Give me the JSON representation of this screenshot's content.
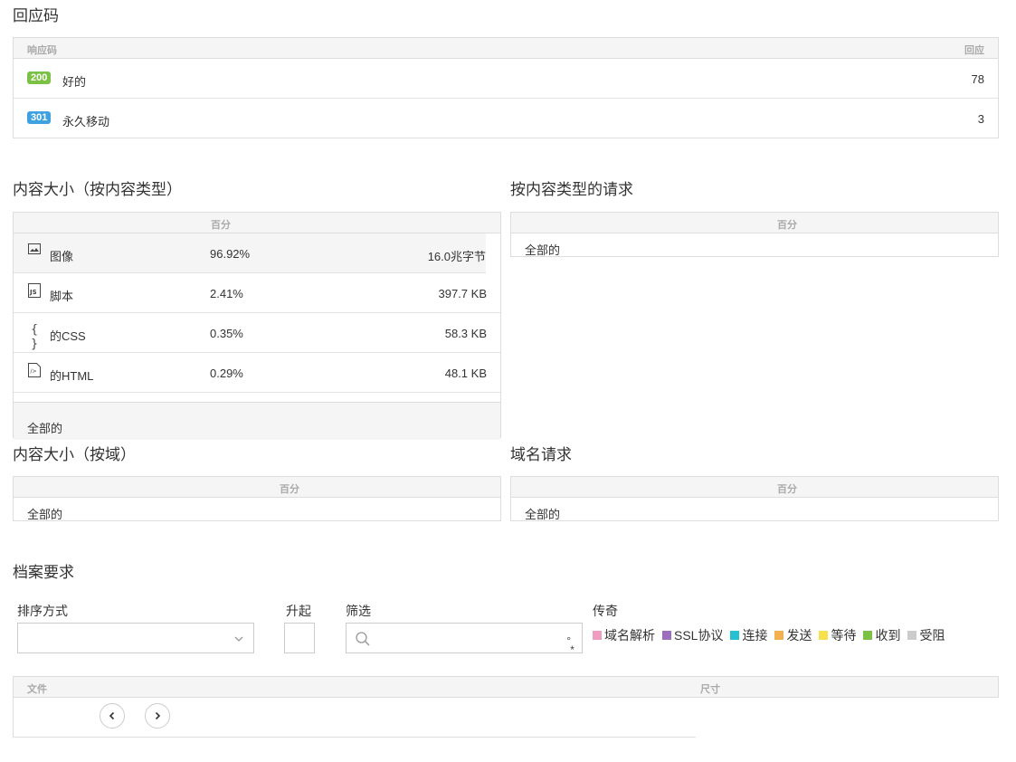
{
  "response_codes": {
    "title": "回应码",
    "header": {
      "code": "响应码",
      "count": "回应"
    },
    "rows": [
      {
        "badge": "200",
        "badge_color": "#7bc143",
        "label": "好的",
        "count": "78"
      },
      {
        "badge": "301",
        "badge_color": "#3ea1e0",
        "label": "永久移动",
        "count": "3"
      }
    ]
  },
  "content_size_by_type": {
    "title": "内容大小（按内容类型）",
    "header": {
      "percent": "百分"
    },
    "rows": [
      {
        "icon": "image-icon",
        "label": "图像",
        "percent": "96.92%",
        "size": "16.0兆字节"
      },
      {
        "icon": "js-file-icon",
        "label": "脚本",
        "percent": "2.41%",
        "size": "397.7 KB"
      },
      {
        "icon": "css-braces-icon",
        "label": "的CSS",
        "percent": "0.35%",
        "size": "58.3 KB"
      },
      {
        "icon": "html-file-icon",
        "label": "的HTML",
        "percent": "0.29%",
        "size": "48.1 KB"
      }
    ],
    "footer": "全部的"
  },
  "requests_by_type": {
    "title": "按内容类型的请求",
    "header": {
      "percent": "百分"
    },
    "footer": "全部的"
  },
  "content_size_by_domain": {
    "title": "内容大小（按域）",
    "header": {
      "percent": "百分"
    },
    "footer": "全部的"
  },
  "domain_requests": {
    "title": "域名请求",
    "header": {
      "percent": "百分"
    },
    "footer": "全部的"
  },
  "har_requests": {
    "title": "档案要求",
    "sort_label": "排序方式",
    "sort_value": "",
    "asc_label": "升起",
    "filter_label": "筛选",
    "filter_value": "",
    "legend_label": "传奇",
    "legend": [
      {
        "label": "域名解析",
        "color": "#f09cc0"
      },
      {
        "label": "SSL协议",
        "color": "#9b6fbe"
      },
      {
        "label": "连接",
        "color": "#26c0d3"
      },
      {
        "label": "发送",
        "color": "#f3b04f"
      },
      {
        "label": "等待",
        "color": "#f7e04a"
      },
      {
        "label": "收到",
        "color": "#7bc143"
      },
      {
        "label": "受阻",
        "color": "#cccccc"
      }
    ],
    "table_header": {
      "file": "文件",
      "size": "尺寸"
    }
  }
}
